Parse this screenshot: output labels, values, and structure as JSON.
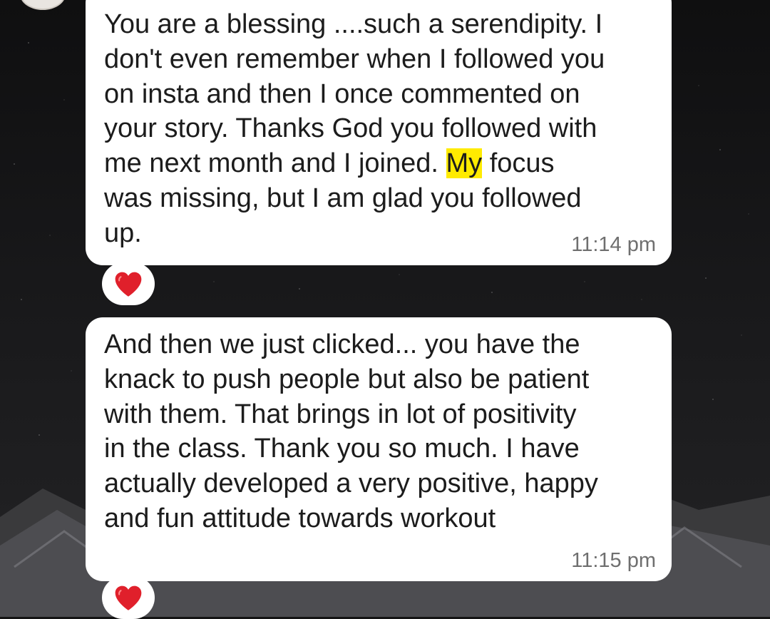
{
  "messages": [
    {
      "text_before": "You are a blessing ....such a serendipity. I\ndon't even remember when I followed you\non insta and then I once commented on\nyour story. Thanks God you followed with\nme next month and I joined. ",
      "highlight": "My",
      "text_after": " focus\nwas missing, but I am glad you followed\nup.",
      "time": "11:14 pm",
      "reaction": "heart-icon"
    },
    {
      "text": "And then we just clicked... you have the\nknack to push people but also be patient\nwith them. That brings in lot of positivity\nin the class. Thank you so much. I have\nactually developed a very positive, happy\nand fun attitude towards workout",
      "time": "11:15 pm",
      "reaction": "heart-icon"
    }
  ],
  "colors": {
    "bubble": "#ffffff",
    "highlight": "#ffeb00",
    "heart": "#e0202b",
    "time_text": "#6f6f6f"
  }
}
